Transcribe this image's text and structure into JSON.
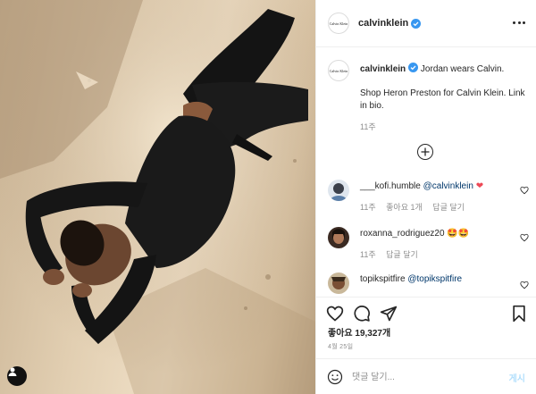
{
  "post": {
    "username": "calvinklein",
    "avatar_text": "Calvin Klein",
    "verified": true,
    "more_icon": "more-horizontal-icon"
  },
  "caption": {
    "username": "calvinklein",
    "line1": "Jordan wears Calvin.",
    "line2": "Shop Heron Preston for Calvin Klein. Link in bio.",
    "time": "11주"
  },
  "load_more_icon": "plus-circle-icon",
  "comments": [
    {
      "user": "___kofi.humble",
      "mention": "@calvinklein",
      "emoji": "❤️",
      "time": "11주",
      "likes": "좋아요 1개",
      "reply": "답글 달기"
    },
    {
      "user": "roxanna_rodriguez20",
      "mention": "",
      "emoji": "🤩🤩",
      "time": "11주",
      "likes": "",
      "reply": "답글 달기"
    },
    {
      "user": "topikspitfire",
      "mention": "@topikspitfire",
      "emoji": "",
      "time": "",
      "likes": "",
      "reply": ""
    }
  ],
  "actions": {
    "like_icon": "heart-icon",
    "comment_icon": "comment-icon",
    "share_icon": "paper-plane-icon",
    "save_icon": "bookmark-icon"
  },
  "likes": "좋아요 19,327개",
  "date": "4월 25일",
  "comment_box": {
    "placeholder": "댓글 달기...",
    "post_label": "게시"
  },
  "colors": {
    "accent": "#3897f0",
    "post_disabled": "#b2dffc",
    "heart": "#ed4956"
  }
}
